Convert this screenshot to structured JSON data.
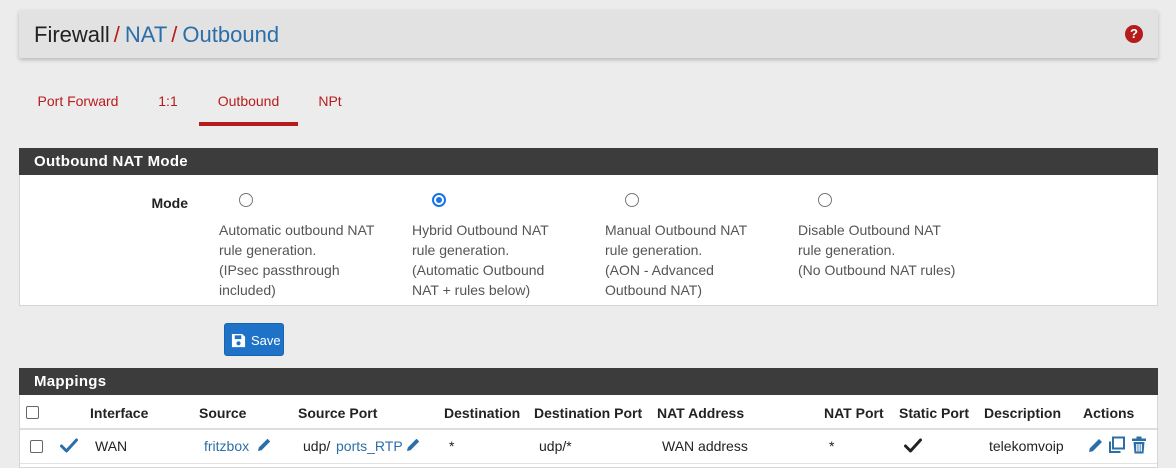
{
  "breadcrumb": {
    "part1": "Firewall",
    "sep1": "/",
    "part2": "NAT",
    "sep2": "/",
    "part3": "Outbound",
    "help_icon": "?"
  },
  "tabs": [
    "Port Forward",
    "1:1",
    "Outbound",
    "NPt"
  ],
  "active_tab": "Outbound",
  "mode_panel": {
    "title": "Outbound NAT Mode",
    "label": "Mode",
    "options": [
      {
        "lines": [
          "Automatic outbound NAT",
          "rule generation.",
          "(IPsec passthrough",
          "included)"
        ],
        "checked": false
      },
      {
        "lines": [
          "Hybrid Outbound NAT",
          "rule generation.",
          "(Automatic Outbound",
          "NAT + rules below)"
        ],
        "checked": true
      },
      {
        "lines": [
          "Manual Outbound NAT",
          "rule generation.",
          "(AON - Advanced",
          "Outbound NAT)"
        ],
        "checked": false
      },
      {
        "lines": [
          "Disable Outbound NAT",
          "rule generation.",
          "(No Outbound NAT rules)"
        ],
        "checked": false
      }
    ]
  },
  "save_label": "Save",
  "mappings": {
    "title": "Mappings",
    "headers": [
      "Interface",
      "Source",
      "Source Port",
      "Destination",
      "Destination Port",
      "NAT Address",
      "NAT Port",
      "Static Port",
      "Description",
      "Actions"
    ],
    "row": {
      "interface": "WAN",
      "source": "fritzbox",
      "source_port_prefix": "udp/",
      "source_port_alias": "ports_RTP",
      "destination": "*",
      "destination_port": "udp/*",
      "nat_address": "WAN address",
      "nat_port": "*",
      "static_port": true,
      "description": "telekomvoip"
    }
  },
  "colors": {
    "accent_red": "#b71c1c",
    "link_blue": "#2c6ea8",
    "header_dark": "#3c3c3c",
    "button_blue": "#1e73c9"
  }
}
